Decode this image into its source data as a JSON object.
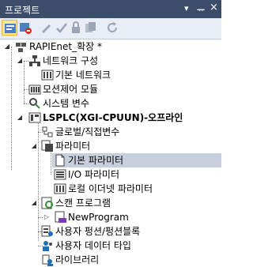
{
  "panel": {
    "title": "프로젝트",
    "pin_glyph": "▾",
    "autohide_glyph": "ᅲ",
    "close_glyph": "×"
  },
  "toolbar": {
    "buttons": [
      "project-view",
      "clear-filter",
      "wrench",
      "check",
      "lock",
      "copy",
      "refresh"
    ]
  },
  "tree": {
    "root": {
      "label": "RAPIEnet_확장 *"
    },
    "network": {
      "label": "네트워크 구성"
    },
    "basic_network": {
      "label": "기본 네트워크"
    },
    "motion": {
      "label": "모션제어 모듈"
    },
    "sysvars": {
      "label": "시스템 변수"
    },
    "plc": {
      "label": "LSPLC(XGI-CPUUN)-오프라인"
    },
    "globals": {
      "label": "글로벌/직접변수"
    },
    "params": {
      "label": "파라미터"
    },
    "basic_params": {
      "label": "기본 파라미터"
    },
    "io_params": {
      "label": "I/O 파라미터"
    },
    "local_eth": {
      "label": "로컬 이더넷 파라미터"
    },
    "scan": {
      "label": "스캔 프로그램"
    },
    "newprog": {
      "label": "NewProgram"
    },
    "udfb": {
      "label": "사용자 펑션/펑션블록"
    },
    "udt": {
      "label": "사용자 데이터 타입"
    },
    "library": {
      "label": "라이브러리"
    }
  }
}
